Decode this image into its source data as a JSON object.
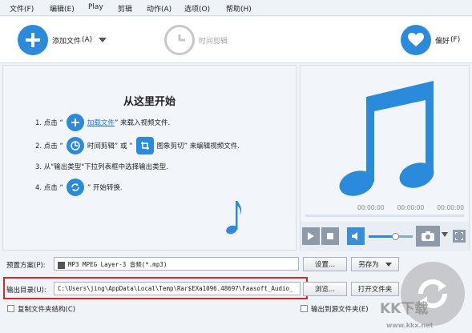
{
  "menu": [
    "文件(F)",
    "编辑(E)",
    "Play",
    "剪辑",
    "动作(A)",
    "选项(O)",
    "帮助(H)"
  ],
  "toolbar": {
    "add_file": "添加文件",
    "add_file_shortcut": "(A)",
    "time_clip": "时间剪辑",
    "favorites": "偏好",
    "favorites_shortcut": "(F)"
  },
  "guide": {
    "title": "从这里开始",
    "step1_pre": "1. 点击 “",
    "step1_link": "加载文件",
    "step1_post": "” 来载入视频文件.",
    "step2_pre": "2. 点击 “",
    "step2_mid1": "时间剪辑” 或 “",
    "step2_mid2": "图象剪切” 来编辑视频文件.",
    "step3": "3. 从\"输出类型\"下拉列表框中选择输出类型.",
    "step4_pre": "4. 点击 “",
    "step4_post": "” 开始转换."
  },
  "preview": {
    "time_current": "00:00:00",
    "time_mid": "00:00:00",
    "time_total": "00:00:00",
    "volume_level": 0.6
  },
  "preset": {
    "label": "预置方案(P):",
    "value": "MP3 MPEG Layer-3 音频(*.mp3)",
    "settings_button": "设置...",
    "save_as_button": "另存为"
  },
  "output": {
    "label": "输出目录(U):",
    "path": "C:\\Users\\jing\\AppData\\Local\\Temp\\Rar$EXa1096.48697\\Faasoft_Audio_",
    "browse_button": "浏览...",
    "open_folder_button": "打开文件夹"
  },
  "options": {
    "copy_structure": "复制文件夹结构(C)",
    "output_to_source": "输出到源文件夹(E)"
  },
  "watermark": {
    "brand": "KK下载",
    "url": "www.kkx.net"
  }
}
